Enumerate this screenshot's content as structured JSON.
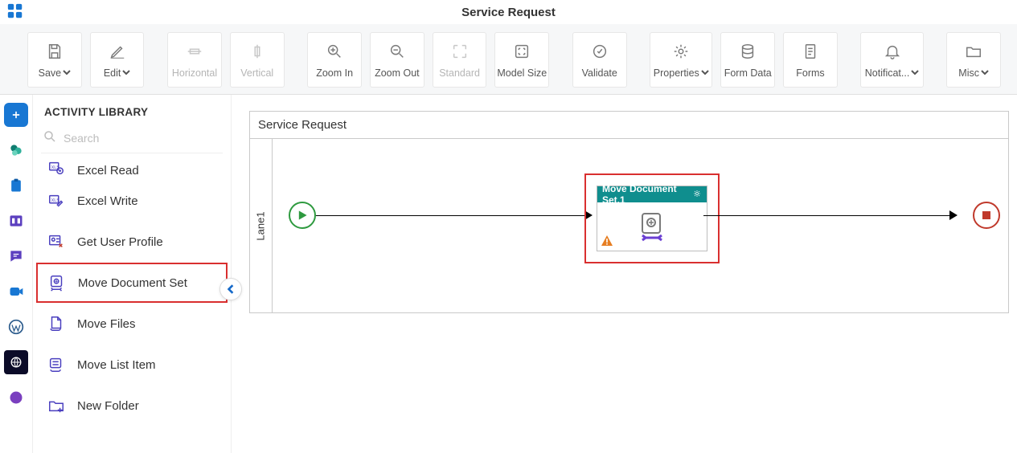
{
  "page_title": "Service Request",
  "toolbar": {
    "save": "Save",
    "edit": "Edit",
    "horizontal": "Horizontal",
    "vertical": "Vertical",
    "zoom_in": "Zoom In",
    "zoom_out": "Zoom Out",
    "standard": "Standard",
    "model_size": "Model Size",
    "validate": "Validate",
    "properties": "Properties",
    "form_data": "Form Data",
    "forms": "Forms",
    "notifications": "Notificat...",
    "misc": "Misc"
  },
  "library": {
    "header": "ACTIVITY LIBRARY",
    "search_placeholder": "Search",
    "items": [
      "Excel Read",
      "Excel Write",
      "Get User Profile",
      "Move Document Set",
      "Move Files",
      "Move List Item",
      "New Folder"
    ],
    "selected_index": 3
  },
  "canvas": {
    "title": "Service Request",
    "lane_label": "Lane1",
    "activity_node_title": "Move Document Set.1"
  }
}
